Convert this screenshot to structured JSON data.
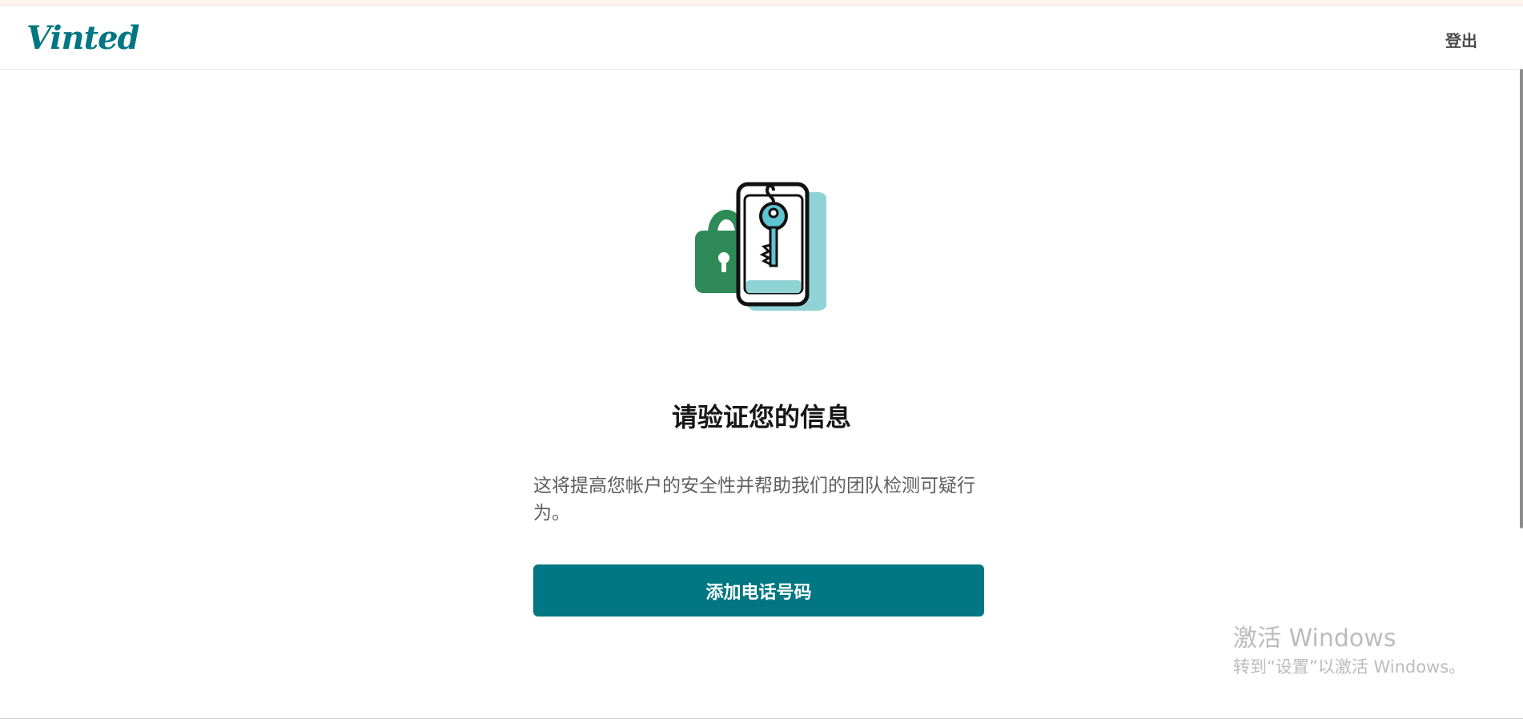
{
  "header": {
    "logo_text": "Vinted",
    "logout_label": "登出"
  },
  "main": {
    "illustration_icon": "padlock-phone-key-icon",
    "title": "请验证您的信息",
    "description": "这将提高您帐户的安全性并帮助我们的团队检测可疑行为。",
    "button_label": "添加电话号码"
  },
  "watermark": {
    "title": "激活 Windows",
    "subtitle": "转到“设置”以激活 Windows。"
  },
  "colors": {
    "brand": "#007782",
    "lock_green": "#2e8b57",
    "phone_teal": "#8fd3d6"
  }
}
